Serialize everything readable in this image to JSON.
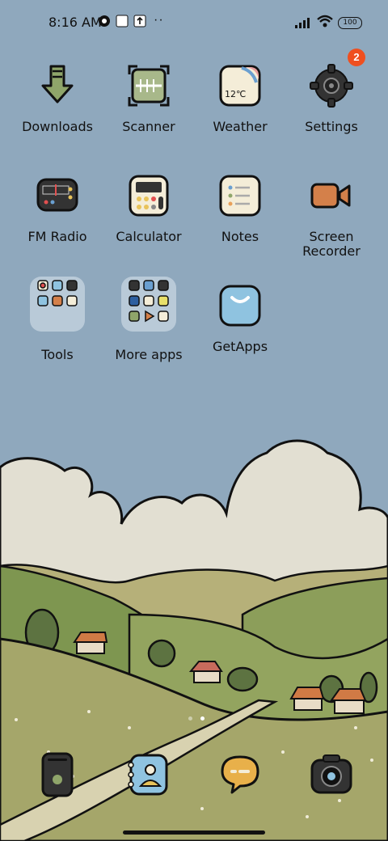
{
  "status_bar": {
    "time": "8:16 AM",
    "battery": "100"
  },
  "apps": [
    {
      "label": "Downloads"
    },
    {
      "label": "Scanner"
    },
    {
      "label": "Weather",
      "icon_text": "12℃"
    },
    {
      "label": "Settings",
      "badge": "2"
    },
    {
      "label": "FM Radio"
    },
    {
      "label": "Calculator"
    },
    {
      "label": "Notes"
    },
    {
      "label": "Screen Recorder"
    },
    {
      "label": "Tools"
    },
    {
      "label": "More apps"
    },
    {
      "label": "GetApps"
    }
  ],
  "dock": [
    {
      "name": "phone"
    },
    {
      "name": "contacts"
    },
    {
      "name": "messages"
    },
    {
      "name": "camera"
    }
  ],
  "pager": {
    "pages": 2,
    "current": 2
  },
  "colors": {
    "sky": "#8fa8bd",
    "cloud": "#e2dfd2",
    "grass": "#a5a66a",
    "badge": "#ef4f1f"
  }
}
